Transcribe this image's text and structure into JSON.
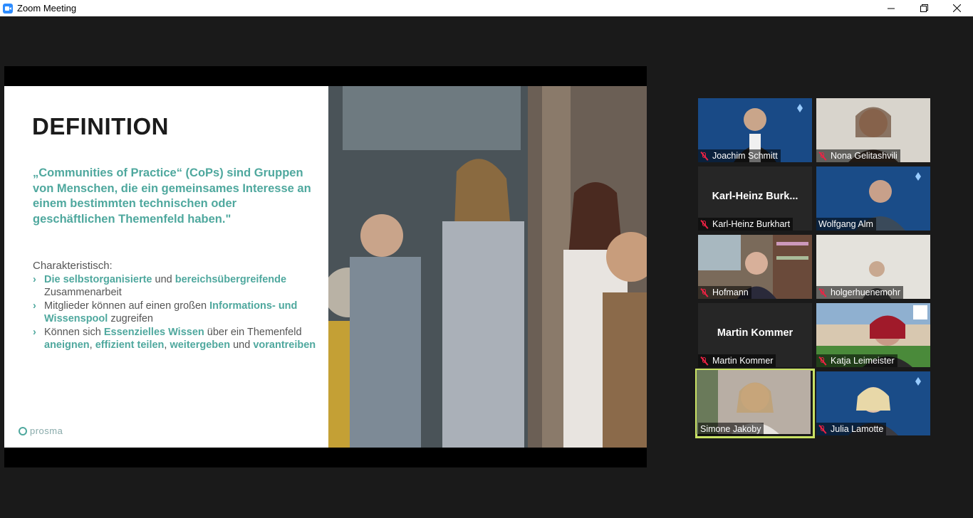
{
  "window": {
    "title": "Zoom Meeting",
    "icon": "zoom-camera-icon",
    "controls": [
      "minimize-icon",
      "restore-icon",
      "close-icon"
    ]
  },
  "slide": {
    "title": "DEFINITION",
    "quote": "„Communities of Practice“ (CoPs) sind Gruppen von Menschen, die ein gemeinsames Interesse an einem bestimmten technischen oder geschäftlichen Themenfeld haben.\"",
    "characteristic_heading": "Charakteristisch:",
    "bullets": [
      {
        "p1": "Die selbstorganisierte",
        "p2": " und ",
        "p3": "bereichsübergreifende",
        "p4": " Zusammenarbeit"
      },
      {
        "p1": "Mitglieder können auf einen großen ",
        "p2": "Informations- und Wissenspool",
        "p3": " zugreifen"
      },
      {
        "p1": "Können sich ",
        "p2": "Essenzielles Wissen",
        "p3": " über ein Themenfeld ",
        "p4": "aneignen",
        "p5": ", ",
        "p6": "effizient teilen",
        "p7": ", ",
        "p8": "weitergeben",
        "p9": " und ",
        "p10": "vorantreiben"
      }
    ],
    "logo_text": "prosma",
    "accent_color": "#4fa89e"
  },
  "participants": [
    {
      "name": "Joachim Schmitt",
      "muted": true,
      "video": true
    },
    {
      "name": "Nona Gelitashvili",
      "muted": true,
      "video": true
    },
    {
      "name": "Karl-Heinz Burkhart",
      "display": "Karl-Heinz  Burk...",
      "muted": true,
      "video": false
    },
    {
      "name": "Wolfgang Alm",
      "muted": false,
      "video": true
    },
    {
      "name": "Hofmann",
      "muted": true,
      "video": true
    },
    {
      "name": "holgerhuenemohr",
      "muted": true,
      "video": true
    },
    {
      "name": "Martin Kommer",
      "display": "Martin Kommer",
      "muted": true,
      "video": false
    },
    {
      "name": "Katja Leimeister",
      "muted": true,
      "video": true
    },
    {
      "name": "Simone Jakoby",
      "muted": false,
      "video": true,
      "speaking": true
    },
    {
      "name": "Julia Lamotte",
      "muted": true,
      "video": true
    }
  ]
}
